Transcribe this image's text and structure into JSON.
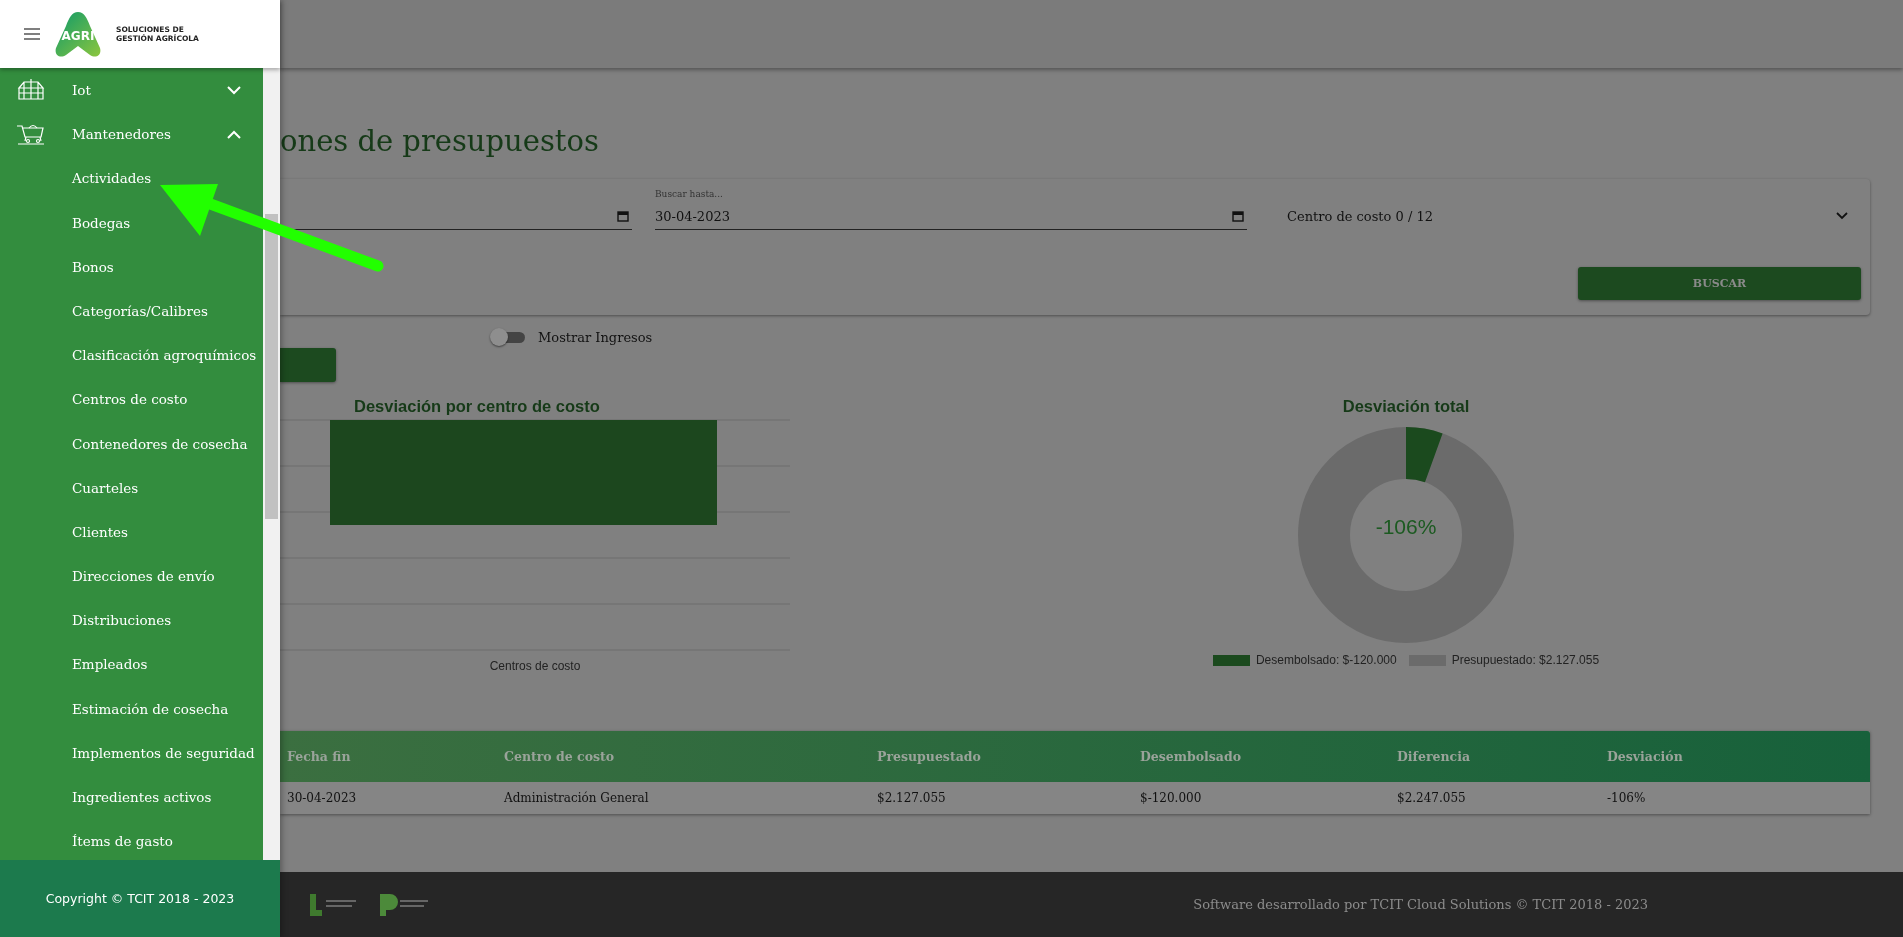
{
  "sidebar": {
    "brand": {
      "logo_text": "AGRI",
      "line_1": "SOLUCIONES DE",
      "line_2": "GESTIÓN AGRÍCOLA"
    },
    "items": [
      {
        "label": "Iot",
        "kind": "group",
        "expanded": false
      },
      {
        "label": "Mantenedores",
        "kind": "group",
        "expanded": true,
        "children": [
          {
            "label": "Actividades"
          },
          {
            "label": "Bodegas"
          },
          {
            "label": "Bonos"
          },
          {
            "label": "Categorías/Calibres"
          },
          {
            "label": "Clasificación agroquímicos"
          },
          {
            "label": "Centros de costo"
          },
          {
            "label": "Contenedores de cosecha"
          },
          {
            "label": "Cuarteles"
          },
          {
            "label": "Clientes"
          },
          {
            "label": "Direcciones de envío"
          },
          {
            "label": "Distribuciones"
          },
          {
            "label": "Empleados"
          },
          {
            "label": "Estimación de cosecha"
          },
          {
            "label": "Implementos de seguridad"
          },
          {
            "label": "Ingredientes activos"
          },
          {
            "label": "Ítems de gasto"
          }
        ]
      }
    ],
    "copyright": "Copyright © TCIT 2018 - 2023"
  },
  "page": {
    "title": "ones de presupuestos"
  },
  "filters": {
    "fields": [
      {
        "kind": "date"
      },
      {
        "kind": "date",
        "label": "Buscar hasta...",
        "value": "30-04-2023"
      },
      {
        "kind": "select",
        "value": "Centro de costo 0 / 12"
      }
    ],
    "button": "BUSCAR"
  },
  "toggle": {
    "label": "Mostrar Ingresos",
    "on": false
  },
  "charts": {
    "bar": {
      "title": "Desviación por centro de costo",
      "xlabel": "Centros de costo"
    },
    "donut": {
      "title": "Desviación total",
      "center_label": "-106%",
      "legend": [
        {
          "label": "Desembolsado: $-120.000",
          "color": "#1b4a1e"
        },
        {
          "label": "Presupuestado: $2.127.055",
          "color": "#6b6b6b"
        }
      ]
    }
  },
  "table": {
    "columns": [
      "Fecha fin",
      "Centro de costo",
      "Presupuestado",
      "Desembolsado",
      "Diferencia",
      "Desviación"
    ],
    "rows": [
      [
        "30-04-2023",
        "Administración General",
        "$2.127.055",
        "$-120.000",
        "$2.247.055",
        "-106%"
      ]
    ]
  },
  "footer": {
    "credit": "Software desarrollado por TCIT Cloud Solutions © TCIT 2018 - 2023"
  }
}
